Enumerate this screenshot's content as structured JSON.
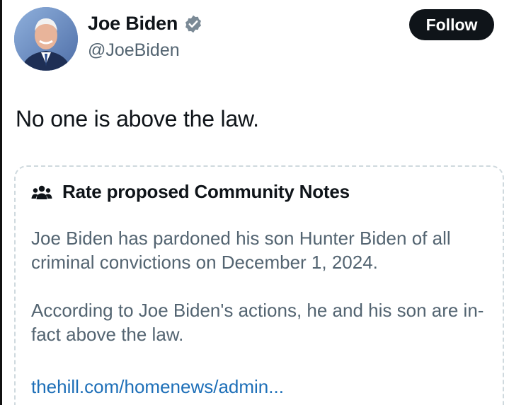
{
  "tweet": {
    "author": {
      "display_name": "Joe Biden",
      "handle": "@JoeBiden",
      "verified": true,
      "avatar_icon": "profile-photo"
    },
    "follow_label": "Follow",
    "text": "No one is above the law."
  },
  "community_note": {
    "header_icon": "people-icon",
    "title": "Rate proposed Community Notes",
    "paragraphs": [
      "Joe Biden has pardoned his son Hunter Biden of all criminal convictions on December 1, 2024.",
      "According to Joe Biden's actions, he and his son are in-fact above the law."
    ],
    "link_text": "thehill.com/homenews/admin..."
  },
  "colors": {
    "text_primary": "#0f1419",
    "text_secondary": "#536471",
    "link": "#1d6fb8",
    "border": "#cfd9de",
    "button_bg": "#0f1419"
  }
}
